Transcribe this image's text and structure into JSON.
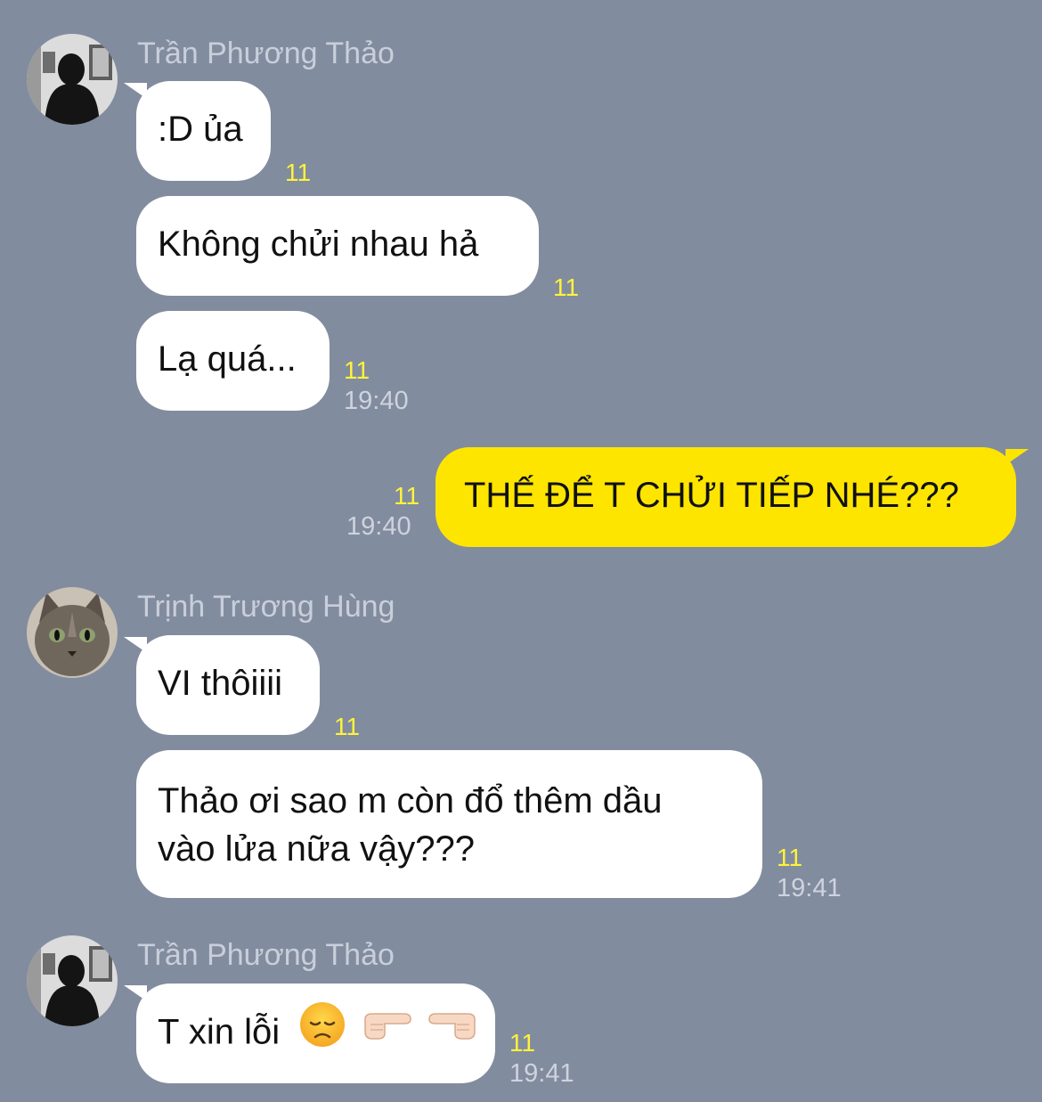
{
  "senders": {
    "thao": "Trần Phương Thảo",
    "hung": "Trịnh Trương Hùng"
  },
  "messages": {
    "m1": ":D ủa",
    "m2": "Không chửi nhau hả",
    "m3": "Lạ quá...",
    "m4": "THẾ ĐỂ T CHỬI TIẾP NHÉ???",
    "m5": "VI thôiiii",
    "m6_line1": "Thảo ơi sao m còn đổ thêm dầu",
    "m6_line2": "vào lửa nữa vậy???",
    "m7": "T xin lỗi"
  },
  "unread_count": "11",
  "times": {
    "t1": "19:40",
    "t2": "19:40",
    "t3": "19:41",
    "t4": "19:41"
  },
  "icons": [
    "disappointed-face-emoji",
    "pointing-right-emoji",
    "pointing-left-emoji"
  ],
  "colors": {
    "background": "#828C9F",
    "my_bubble": "#FEE500",
    "other_bubble": "#FFFFFF",
    "unread": "#FFF33A"
  }
}
